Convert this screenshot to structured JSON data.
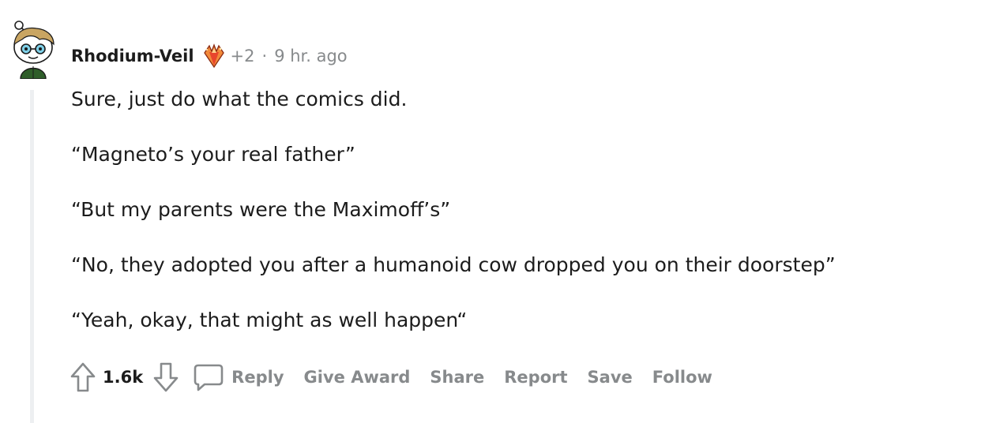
{
  "comment": {
    "author": "Rhodium-Veil",
    "flair_icon": "crystal-flair-icon",
    "award_count": "+2",
    "separator": "·",
    "timestamp": "9 hr. ago",
    "paragraphs": [
      "Sure, just do what the comics did.",
      "“Magneto’s your real father”",
      "“But my parents were the Maximoff’s”",
      "“No, they adopted you after a humanoid cow dropped you on their doorstep”",
      "“Yeah, okay, that might as well happen“"
    ],
    "score": "1.6k"
  },
  "actions": {
    "upvote_icon": "upvote-arrow-icon",
    "downvote_icon": "downvote-arrow-icon",
    "comment_icon": "speech-bubble-icon",
    "reply": "Reply",
    "give_award": "Give Award",
    "share": "Share",
    "report": "Report",
    "save": "Save",
    "follow": "Follow"
  },
  "colors": {
    "text": "#1c1c1c",
    "meta": "#878a8c",
    "thread_line": "#edeff1"
  }
}
